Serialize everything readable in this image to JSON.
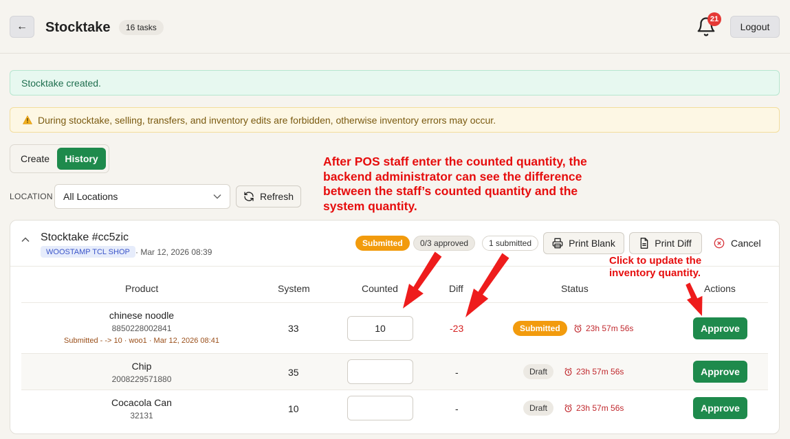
{
  "header": {
    "back_label": "←",
    "title": "Stocktake",
    "task_count": "16 tasks",
    "notification_count": "21",
    "logout_label": "Logout"
  },
  "alerts": {
    "success": "Stocktake created.",
    "warning": "During stocktake, selling, transfers, and inventory edits are forbidden, otherwise inventory errors may occur."
  },
  "tabs": [
    {
      "label": "Create",
      "active": false
    },
    {
      "label": "History",
      "active": true
    }
  ],
  "filter": {
    "location_label": "LOCATION",
    "location_value": "All Locations",
    "refresh_label": "Refresh"
  },
  "annotations": {
    "top": "After POS staff enter the counted quantity, the backend administrator can see the difference between the staff’s counted quantity and the system quantity.",
    "right": "Click to update the inventory quantity."
  },
  "stocktake": {
    "title": "Stocktake #cc5zic",
    "shop": "WOOSTAMP TCL SHOP",
    "date": "· Mar 12, 2026 08:39",
    "status_badge": "Submitted",
    "approved_count": "0/3 approved",
    "submitted_count": "1 submitted",
    "print_blank_label": "Print Blank",
    "print_diff_label": "Print Diff",
    "cancel_label": "Cancel",
    "columns": [
      "Product",
      "System",
      "Counted",
      "Diff",
      "Status",
      "Actions"
    ],
    "rows": [
      {
        "name": "chinese noodle",
        "sku": "8850228002841",
        "note": "Submitted - -> 10 · woo1 · Mar 12, 2026 08:41",
        "system": "33",
        "counted": "10",
        "diff": "-23",
        "status": "Submitted",
        "timer": "23h 57m 56s",
        "action": "Approve"
      },
      {
        "name": "Chip",
        "sku": "2008229571880",
        "note": "",
        "system": "35",
        "counted": "",
        "diff": "-",
        "status": "Draft",
        "timer": "23h 57m 56s",
        "action": "Approve"
      },
      {
        "name": "Cocacola Can",
        "sku": "32131",
        "note": "",
        "system": "10",
        "counted": "",
        "diff": "-",
        "status": "Draft",
        "timer": "23h 57m 56s",
        "action": "Approve"
      }
    ]
  },
  "colors": {
    "primary_green": "#1e8a4c",
    "submitted_orange": "#f29b0d",
    "annotation_red": "#e60d0d",
    "diff_red": "#d52020"
  }
}
